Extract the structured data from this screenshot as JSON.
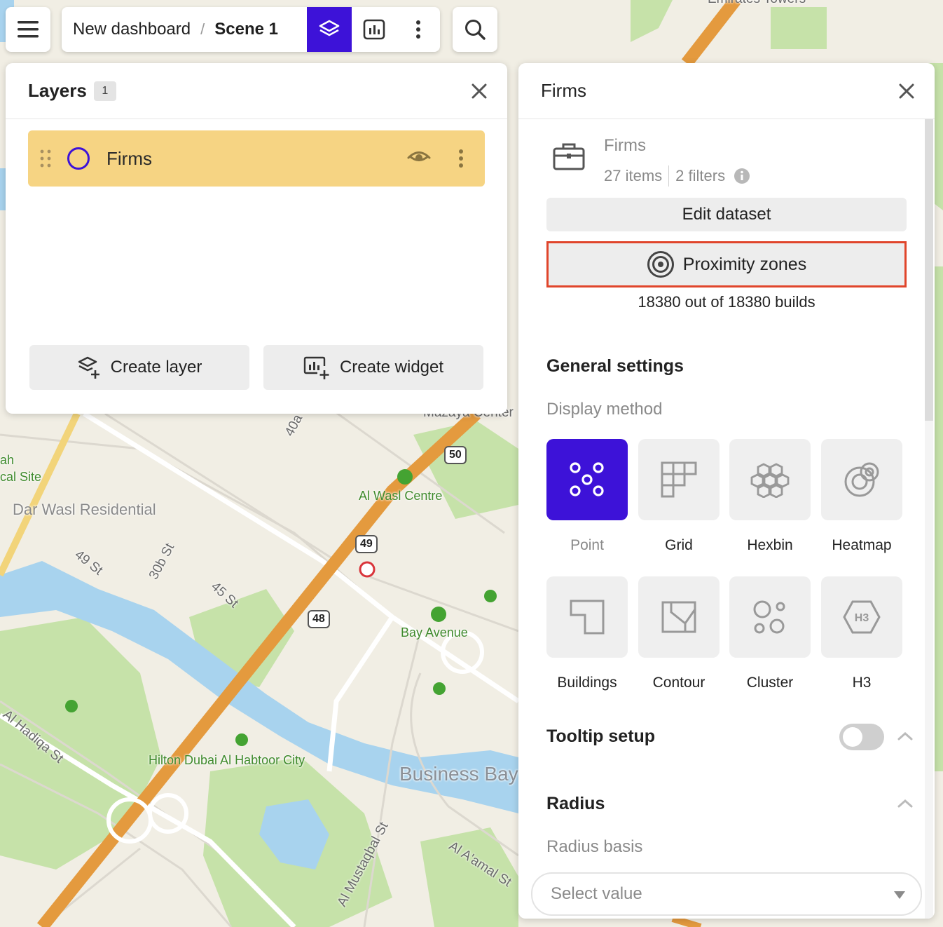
{
  "colors": {
    "accent": "#3d12d8",
    "layer_highlight": "#f6d483",
    "proximity_border": "#e0452b"
  },
  "topbar": {
    "menu_icon": "hamburger-icon",
    "breadcrumb": {
      "dashboard": "New dashboard",
      "separator": "/",
      "scene": "Scene 1"
    },
    "tabs": [
      {
        "name": "layers-icon",
        "active": true
      },
      {
        "name": "dashboard-chart-icon",
        "active": false
      },
      {
        "name": "more-vertical-icon",
        "active": false
      }
    ],
    "search_icon": "search-icon"
  },
  "layers_panel": {
    "title": "Layers",
    "count": "1",
    "layers": [
      {
        "name": "Firms"
      }
    ],
    "create_layer": "Create layer",
    "create_widget": "Create widget"
  },
  "firms_panel": {
    "title": "Firms",
    "dataset": {
      "name": "Firms",
      "items": "27 items",
      "filters": "2 filters"
    },
    "edit_dataset": "Edit dataset",
    "proximity_zones": "Proximity zones",
    "builds": "18380 out of 18380 builds",
    "general_settings": "General settings",
    "display_method_label": "Display method",
    "methods": [
      {
        "label": "Point",
        "icon": "point-icon",
        "active": true
      },
      {
        "label": "Grid",
        "icon": "grid-icon",
        "active": false
      },
      {
        "label": "Hexbin",
        "icon": "hexbin-icon",
        "active": false
      },
      {
        "label": "Heatmap",
        "icon": "heatmap-icon",
        "active": false
      },
      {
        "label": "Buildings",
        "icon": "buildings-icon",
        "active": false
      },
      {
        "label": "Contour",
        "icon": "contour-icon",
        "active": false
      },
      {
        "label": "Cluster",
        "icon": "cluster-icon",
        "active": false
      },
      {
        "label": "H3",
        "icon": "h3-icon",
        "active": false
      }
    ],
    "tooltip_setup": "Tooltip setup",
    "tooltip_enabled": false,
    "radius": "Radius",
    "radius_basis_label": "Radius basis",
    "radius_select_placeholder": "Select value"
  },
  "map": {
    "labels": {
      "emirates_towers": "Emirates Towers",
      "mazaya_center": "Mazaya Center",
      "al_wasl_centre": "Al Wasl Centre",
      "dar_wasl": "Dar Wasl Residential",
      "st_49": "49 St",
      "st_30b": "30b St",
      "st_45": "45 St",
      "st_40a": "40a",
      "bay_avenue": "Bay Avenue",
      "hilton": "Hilton Dubai Al Habtoor City",
      "business_bay": "Business Bay",
      "al_hadiqa": "Al Hadiqa St",
      "al_amal": "Al A'amal St",
      "al_mustaqbal": "Al Mustaqbal St",
      "al_site": "cal Site",
      "ah": "ah"
    },
    "highways": {
      "h50": "50",
      "h49": "49",
      "h48": "48"
    }
  }
}
